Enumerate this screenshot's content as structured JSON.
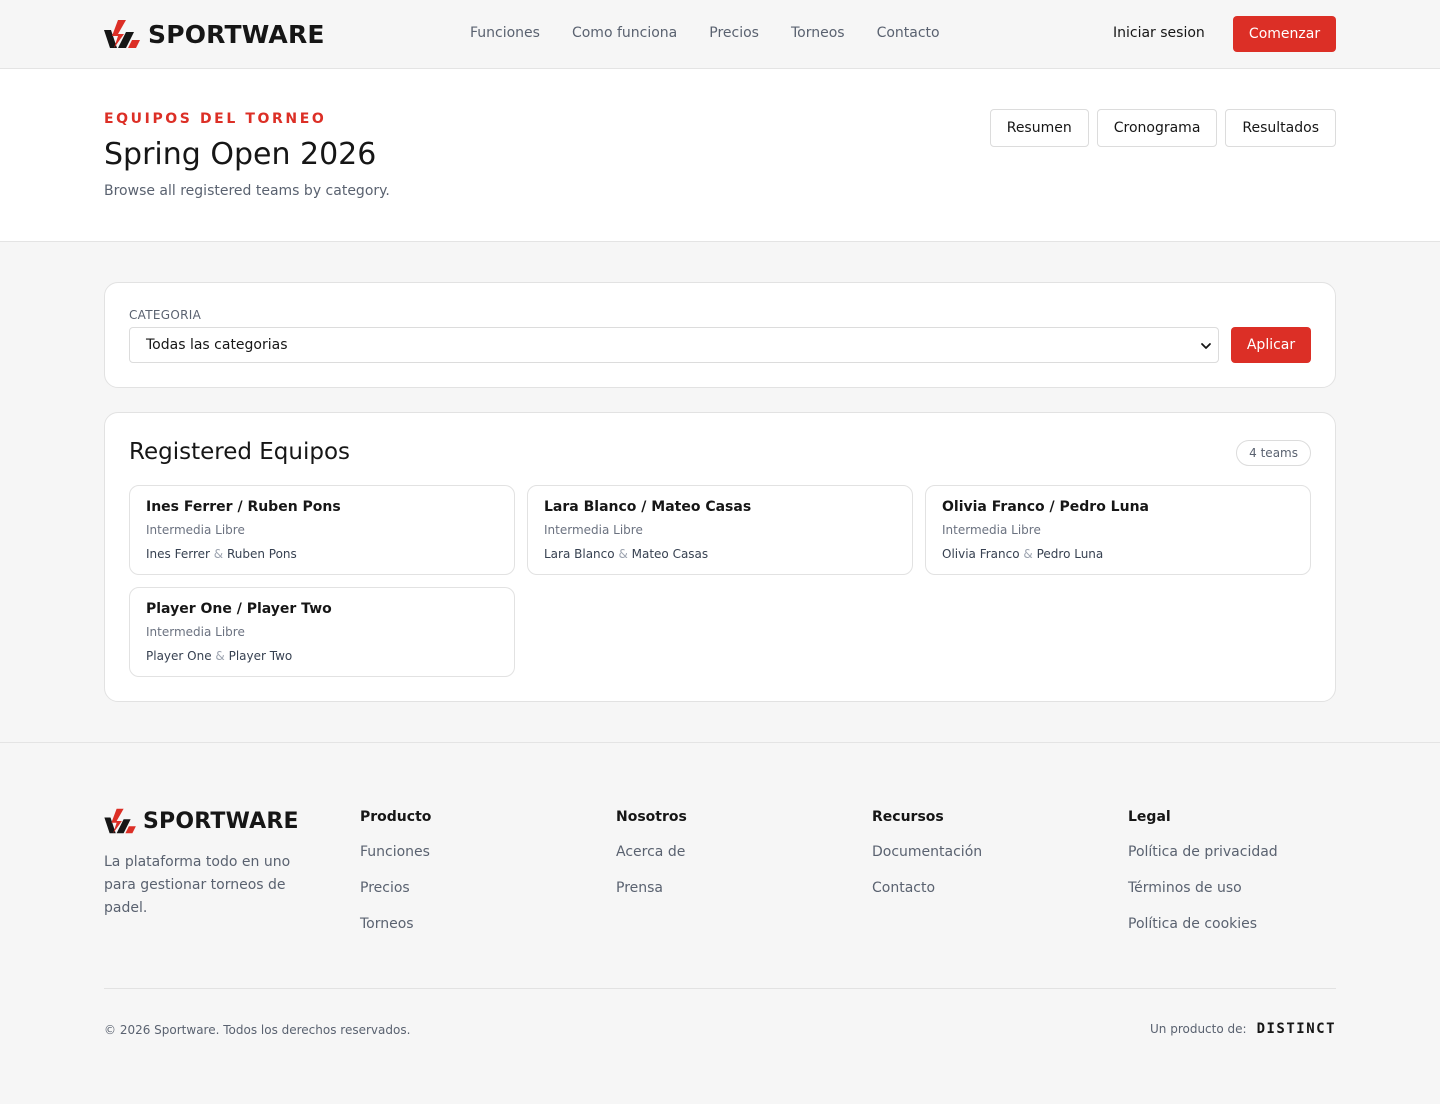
{
  "brand": {
    "name": "SPORTWARE",
    "accent_color": "#dc2f26"
  },
  "header": {
    "nav": [
      "Funciones",
      "Como funciona",
      "Precios",
      "Torneos",
      "Contacto"
    ],
    "login_label": "Iniciar sesion",
    "start_label": "Comenzar"
  },
  "hero": {
    "eyebrow": "EQUIPOS DEL TORNEO",
    "title": "Spring Open 2026",
    "subtitle": "Browse all registered teams by category.",
    "tabs": [
      "Resumen",
      "Cronograma",
      "Resultados"
    ]
  },
  "filter": {
    "label": "CATEGORIA",
    "selected": "Todas las categorias",
    "apply_label": "Aplicar"
  },
  "teams": {
    "title": "Registered Equipos",
    "count_label": "4 teams",
    "items": [
      {
        "name": "Ines Ferrer / Ruben Pons",
        "category": "Intermedia Libre",
        "p1": "Ines Ferrer",
        "p2": "Ruben Pons"
      },
      {
        "name": "Lara Blanco / Mateo Casas",
        "category": "Intermedia Libre",
        "p1": "Lara Blanco",
        "p2": "Mateo Casas"
      },
      {
        "name": "Olivia Franco / Pedro Luna",
        "category": "Intermedia Libre",
        "p1": "Olivia Franco",
        "p2": "Pedro Luna"
      },
      {
        "name": "Player One / Player Two",
        "category": "Intermedia Libre",
        "p1": "Player One",
        "p2": "Player Two"
      }
    ],
    "amp": "&"
  },
  "footer": {
    "tagline": "La plataforma todo en uno para gestionar torneos de padel.",
    "columns": [
      {
        "title": "Producto",
        "links": [
          "Funciones",
          "Precios",
          "Torneos"
        ]
      },
      {
        "title": "Nosotros",
        "links": [
          "Acerca de",
          "Prensa"
        ]
      },
      {
        "title": "Recursos",
        "links": [
          "Documentación",
          "Contacto"
        ]
      },
      {
        "title": "Legal",
        "links": [
          "Política de privacidad",
          "Términos de uso",
          "Política de cookies"
        ]
      }
    ],
    "copyright": "© 2026 Sportware. Todos los derechos reservados.",
    "product_of_label": "Un producto de:",
    "maker": "DISTINCT"
  }
}
